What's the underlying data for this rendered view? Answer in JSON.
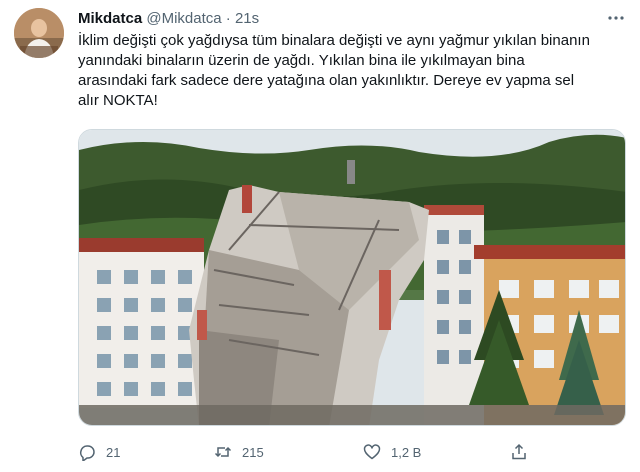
{
  "tweet": {
    "display_name": "Mikdatca",
    "handle": "@Mikdatca",
    "separator": "·",
    "time": "21s",
    "text_lines": [
      "İklim değişti çok yağdıysa tüm binalara değişti ve aynı yağmur yıkılan binanın",
      "yanındaki binaların üzerin de yağdı. Yıkılan bina ile yıkılmayan bina",
      "arasındaki fark sadece dere yatağına olan yakınlıktır. Dereye ev yapma sel",
      "alır NOKTA!"
    ]
  },
  "actions": {
    "reply_count": "21",
    "retweet_count": "215",
    "like_count": "1,2 B"
  },
  "icons": {
    "more": "more-horizontal-icon",
    "reply": "reply-icon",
    "retweet": "retweet-icon",
    "like": "heart-icon",
    "share": "share-icon"
  },
  "colors": {
    "text": "#0f1419",
    "secondary": "#536471",
    "border": "#cfd9de"
  }
}
